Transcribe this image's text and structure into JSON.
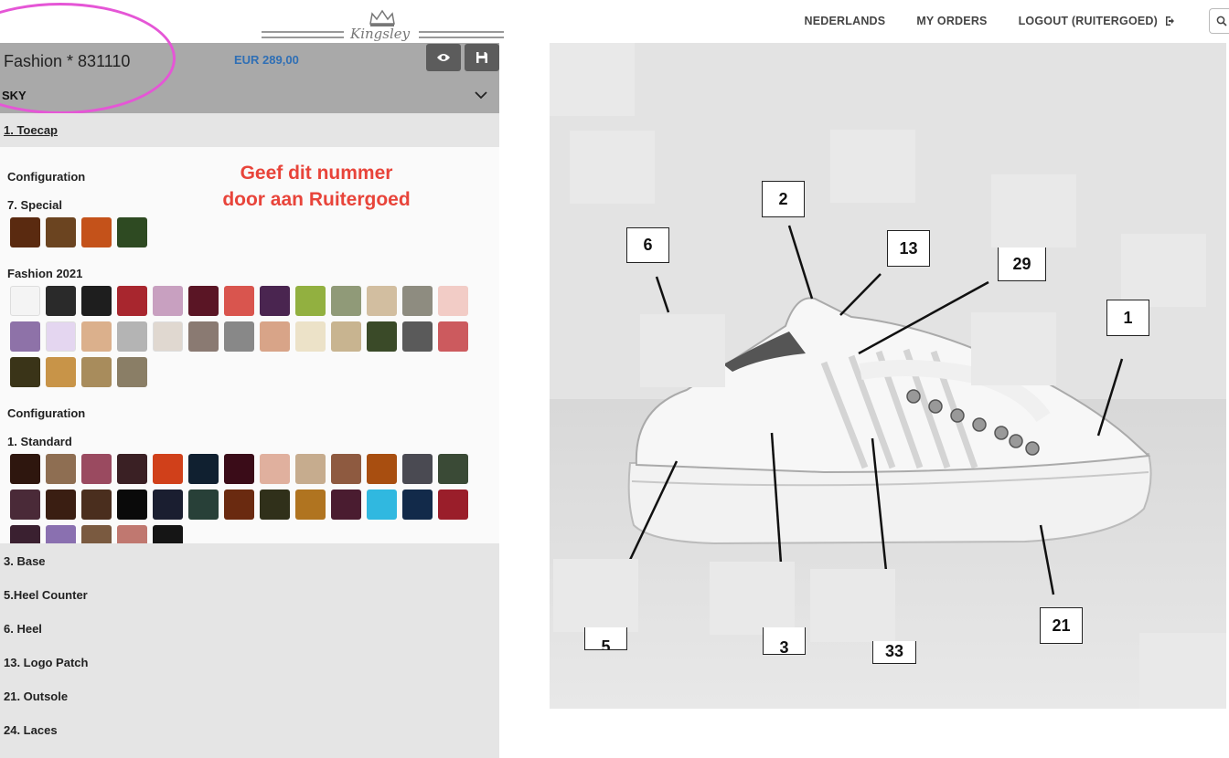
{
  "nav": {
    "language": "NEDERLANDS",
    "orders": "MY ORDERS",
    "logout": "LOGOUT (RUITERGOED)"
  },
  "logo": {
    "brand": "Kingsley"
  },
  "product": {
    "title": "Fashion * 831110",
    "price": "EUR 289,00",
    "model": "SKY",
    "active_section": "1. Toecap"
  },
  "annotation": {
    "note_line1": "Geef dit nummer",
    "note_line2": "door aan Ruitergoed"
  },
  "colors": {
    "accent": "#2f6fb5",
    "note": "#e8443a",
    "highlight": "#e556d6",
    "header": "#a9a9a9"
  },
  "swatch_groups": [
    {
      "config_label": "Configuration",
      "label": "7. Special",
      "rows": [
        [
          "#5a2a10",
          "#6b4420",
          "#c4521a",
          "#2e4a22"
        ]
      ]
    },
    {
      "config_label": "",
      "label": "Fashion 2021",
      "rows": [
        [
          "#f4f4f4",
          "#2a2a2a",
          "#1e1e1e",
          "#a8262e",
          "#c8a0c0",
          "#5a1525",
          "#d9554e",
          "#4a2550",
          "#92b040",
          "#909a78",
          "#d2bea0",
          "#8e8c80",
          "#f2ccc6"
        ],
        [
          "#8e72a8",
          "#e4d6f0",
          "#dbb08c",
          "#b4b4b4",
          "#e0d8d0",
          "#8a7a72",
          "#888888",
          "#d8a488",
          "#ece2c8",
          "#c8b490",
          "#3a4a28",
          "#5a5a5a",
          "#cc5a5e"
        ],
        [
          "#3a3418",
          "#c89448",
          "#a88c5c",
          "#8a7e66"
        ]
      ]
    },
    {
      "config_label": "Configuration",
      "label": "1. Standard",
      "rows": [
        [
          "#2e160e",
          "#8e6e52",
          "#9a4a60",
          "#3a2024",
          "#d0401a",
          "#102030",
          "#3a0c18",
          "#e0b09e",
          "#c6ac8e",
          "#8e5a40",
          "#a84e10",
          "#4a4a52",
          "#3a4a36"
        ],
        [
          "#4a2a38",
          "#3a1e12",
          "#4a2e1e",
          "#0a0a0a",
          "#1a1e30",
          "#284038",
          "#6a2a10",
          "#30301a",
          "#b07420",
          "#4a1c30",
          "#30b8e0",
          "#122a4a",
          "#9a1e2a"
        ],
        [
          "#3a2030",
          "#8a70b0",
          "#7a5a40",
          "#c07870",
          "#151515"
        ]
      ]
    }
  ],
  "sections": [
    "3. Base",
    "5.Heel Counter",
    "6. Heel",
    "13. Logo Patch",
    "21. Outsole",
    "24. Laces"
  ],
  "callouts": [
    "6",
    "2",
    "13",
    "29",
    "1",
    "5",
    "3",
    "33",
    "21"
  ]
}
